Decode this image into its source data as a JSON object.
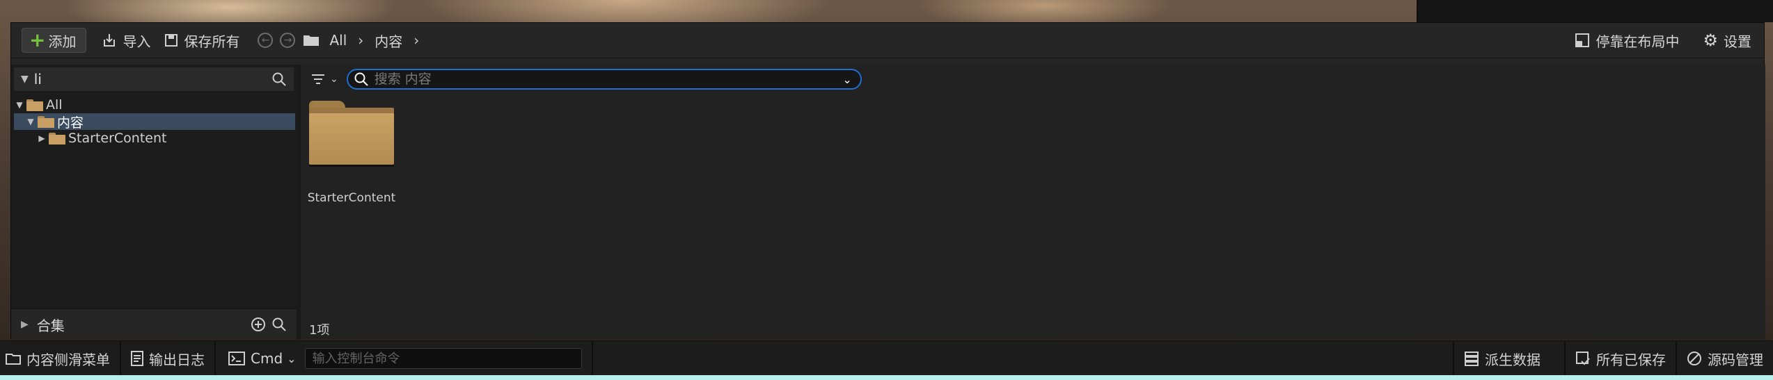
{
  "toolbar": {
    "add_label": "添加",
    "import_label": "导入",
    "save_all_label": "保存所有",
    "breadcrumb": [
      "All",
      "内容"
    ],
    "dock_label": "停靠在布局中",
    "settings_label": "设置"
  },
  "left_panel": {
    "search_value": "li",
    "tree": [
      {
        "label": "All",
        "level": 0,
        "expanded": true,
        "selected": false
      },
      {
        "label": "内容",
        "level": 1,
        "expanded": true,
        "selected": true
      },
      {
        "label": "StarterContent",
        "level": 2,
        "expanded": false,
        "selected": false
      }
    ],
    "collections_label": "合集"
  },
  "content": {
    "search_placeholder": "搜索 内容",
    "items": [
      {
        "label": "StarterContent",
        "icon": "folder-icon"
      }
    ],
    "item_count": "1项"
  },
  "statusbar": {
    "drawer_label": "内容侧滑菜单",
    "output_log_label": "输出日志",
    "cmd_label": "Cmd",
    "console_placeholder": "输入控制台命令",
    "derived_data_label": "派生数据",
    "all_saved_label": "所有已保存",
    "source_control_label": "源码管理"
  },
  "colors": {
    "accent_blue": "#1e6fcf",
    "add_green": "#73c13c",
    "selection": "#3a4b60",
    "folder": "#c8a066"
  }
}
